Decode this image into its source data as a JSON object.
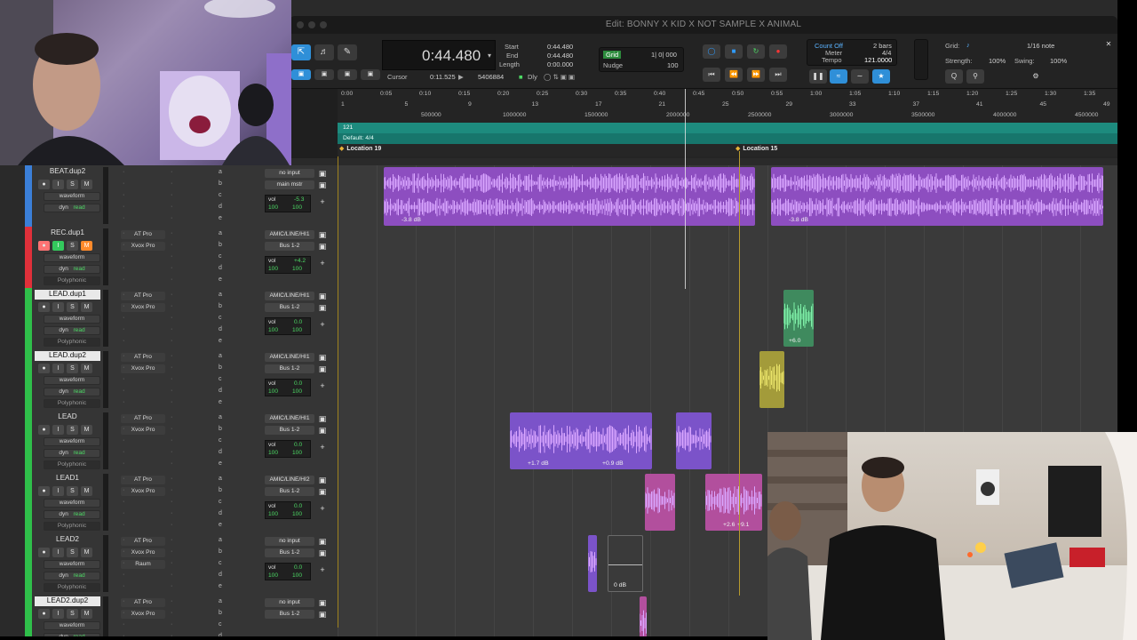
{
  "window": {
    "title": "Edit: BONNY X KID X NOT SAMPLE X ANIMAL"
  },
  "counter": {
    "main": "0:44.480",
    "start_label": "Start",
    "end_label": "End",
    "length_label": "Length",
    "start": "0:44.480",
    "end": "0:44.480",
    "length": "0:00.000",
    "cursor_label": "Cursor",
    "cursor": "0:11.525",
    "sample": "5406884",
    "dly": "Dly"
  },
  "grid_nudge": {
    "grid_label": "Grid",
    "grid_value": "1| 0| 000",
    "nudge_label": "Nudge",
    "nudge_value": "100"
  },
  "count_meter_tempo": {
    "count_off": "Count Off",
    "meter_label": "Meter",
    "tempo_label": "Tempo",
    "bars": "2 bars",
    "meter": "4/4",
    "tempo": "121.0000"
  },
  "grid_panel": {
    "grid_label": "Grid:",
    "grid_value": "1/16 note",
    "strength_label": "Strength:",
    "strength_value": "100%",
    "swing_label": "Swing:",
    "swing_value": "100%"
  },
  "ruler": {
    "minsecs": [
      "0:00",
      "0:05",
      "0:10",
      "0:15",
      "0:20",
      "0:25",
      "0:30",
      "0:35",
      "0:40",
      "0:45",
      "0:50",
      "0:55",
      "1:00",
      "1:05",
      "1:10",
      "1:15",
      "1:20",
      "1:25",
      "1:30",
      "1:35"
    ],
    "bars": [
      "1",
      "5",
      "9",
      "13",
      "17",
      "21",
      "25",
      "29",
      "33",
      "37",
      "41",
      "45",
      "49"
    ],
    "samples": [
      "500000",
      "1000000",
      "1500000",
      "2000000",
      "2500000",
      "3000000",
      "3500000",
      "4000000",
      "4500000"
    ],
    "tempo_value": "121",
    "meter_value": "Default: 4/4",
    "markers": [
      "Location 19",
      "Location 15"
    ]
  },
  "tracks": [
    {
      "name": "BEAT.dup2",
      "color": "#3b7fd8",
      "insert1": "",
      "insert2": "",
      "input": "no input",
      "output": "main mstr",
      "vol": "-5.3",
      "pan_l": "100",
      "pan_r": "100",
      "extra": "",
      "rec": false,
      "selected": false
    },
    {
      "name": "REC.dup1",
      "color": "#e0303a",
      "insert1": "AT Pro",
      "insert2": "Xvox Pro",
      "input": "AMIC/LINE/HI1",
      "output": "Bus 1-2",
      "vol": "+4.2",
      "pan_l": "100",
      "pan_r": "100",
      "extra": "Polyphonic",
      "rec": true,
      "selected": false
    },
    {
      "name": "LEAD.dup1",
      "color": "#2fbf4a",
      "insert1": "AT Pro",
      "insert2": "Xvox Pro",
      "input": "AMIC/LINE/HI1",
      "output": "Bus 1-2",
      "vol": "0.0",
      "pan_l": "100",
      "pan_r": "100",
      "extra": "Polyphonic",
      "rec": false,
      "selected": true
    },
    {
      "name": "LEAD.dup2",
      "color": "#2fbf4a",
      "insert1": "AT Pro",
      "insert2": "Xvox Pro",
      "input": "AMIC/LINE/HI1",
      "output": "Bus 1-2",
      "vol": "0.0",
      "pan_l": "100",
      "pan_r": "100",
      "extra": "Polyphonic",
      "rec": false,
      "selected": true
    },
    {
      "name": "LEAD",
      "color": "#2fbf4a",
      "insert1": "AT Pro",
      "insert2": "Xvox Pro",
      "input": "AMIC/LINE/HI1",
      "output": "Bus 1-2",
      "vol": "0.0",
      "pan_l": "100",
      "pan_r": "100",
      "extra": "Polyphonic",
      "rec": false,
      "selected": false
    },
    {
      "name": "LEAD1",
      "color": "#2fbf4a",
      "insert1": "AT Pro",
      "insert2": "Xvox Pro",
      "input": "AMIC/LINE/HI2",
      "output": "Bus 1-2",
      "vol": "0.0",
      "pan_l": "100",
      "pan_r": "100",
      "extra": "Polyphonic",
      "rec": false,
      "selected": false
    },
    {
      "name": "LEAD2",
      "color": "#2fbf4a",
      "insert1": "AT Pro",
      "insert2": "Xvox Pro",
      "insert3": "Raum",
      "input": "no input",
      "output": "Bus 1-2",
      "vol": "0.0",
      "pan_l": "100",
      "pan_r": "100",
      "extra": "Polyphonic",
      "rec": false,
      "selected": false
    },
    {
      "name": "LEAD2.dup2",
      "color": "#2fbf4a",
      "insert1": "AT Pro",
      "insert2": "Xvox Pro",
      "input": "no input",
      "output": "Bus 1-2",
      "vol": "",
      "pan_l": "",
      "pan_r": "",
      "extra": "",
      "rec": false,
      "selected": true
    }
  ],
  "track_labels": {
    "waveform": "waveform",
    "dyn": "dyn",
    "read": "read",
    "vol": "vol",
    "i": "I",
    "s": "S",
    "m": "M",
    "send_letters": [
      "a",
      "b",
      "c",
      "d",
      "e"
    ]
  },
  "clip_gains": {
    "beat_1": "-3.8 dB",
    "beat_2": "-3.8 dB",
    "lead_dup1": "+6.0",
    "lead_1": "+1.7 dB",
    "lead_2": "+0.9 dB",
    "lead1_1": "+2.6",
    "lead1_2": "+9.1",
    "lead2": "0 dB"
  },
  "colors": {
    "beat_clip": "#8d4ec0",
    "lead_clip": "#7b53c9",
    "lead_dup1_clip": "#3f8a5e",
    "lead_dup2_clip": "#a39b3a",
    "lead1_clip": "#b24f9d",
    "tempo_ruler": "#1d8b7e"
  }
}
